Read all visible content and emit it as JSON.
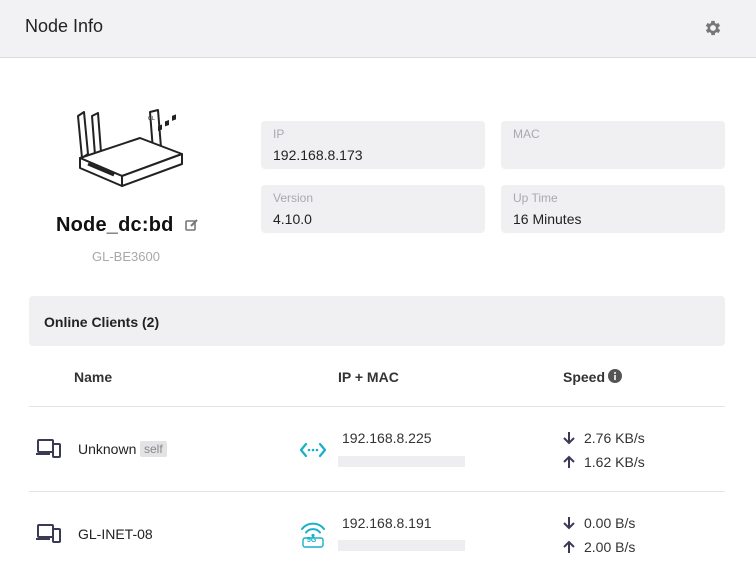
{
  "header": {
    "title": "Node Info",
    "settings_icon": "gear-icon"
  },
  "node": {
    "name": "Node_dc:bd",
    "model": "GL-BE3600",
    "image_icon": "router-icon",
    "edit_icon": "edit-icon"
  },
  "info": {
    "ip": {
      "label": "IP",
      "value": "192.168.8.173"
    },
    "mac": {
      "label": "MAC",
      "value": ""
    },
    "version": {
      "label": "Version",
      "value": "4.10.0"
    },
    "uptime": {
      "label": "Up Time",
      "value": "16 Minutes"
    }
  },
  "clients": {
    "title": "Online Clients (2)",
    "columns": {
      "name": "Name",
      "ip_mac": "IP + MAC",
      "speed": "Speed"
    },
    "rows": [
      {
        "name": "Unknown",
        "badge": "self",
        "connection": "wired-icon",
        "ip": "192.168.8.225",
        "download": "2.76 KB/s",
        "upload": "1.62 KB/s"
      },
      {
        "name": "GL-INET-08",
        "badge": "",
        "connection": "wifi-5g-icon",
        "connection_label": "5G",
        "ip": "192.168.8.191",
        "download": "0.00 B/s",
        "upload": "2.00 B/s"
      }
    ]
  },
  "colors": {
    "accent": "#17b0c8",
    "header_bg": "#f2f2f4",
    "card_bg": "#f0f0f3"
  }
}
